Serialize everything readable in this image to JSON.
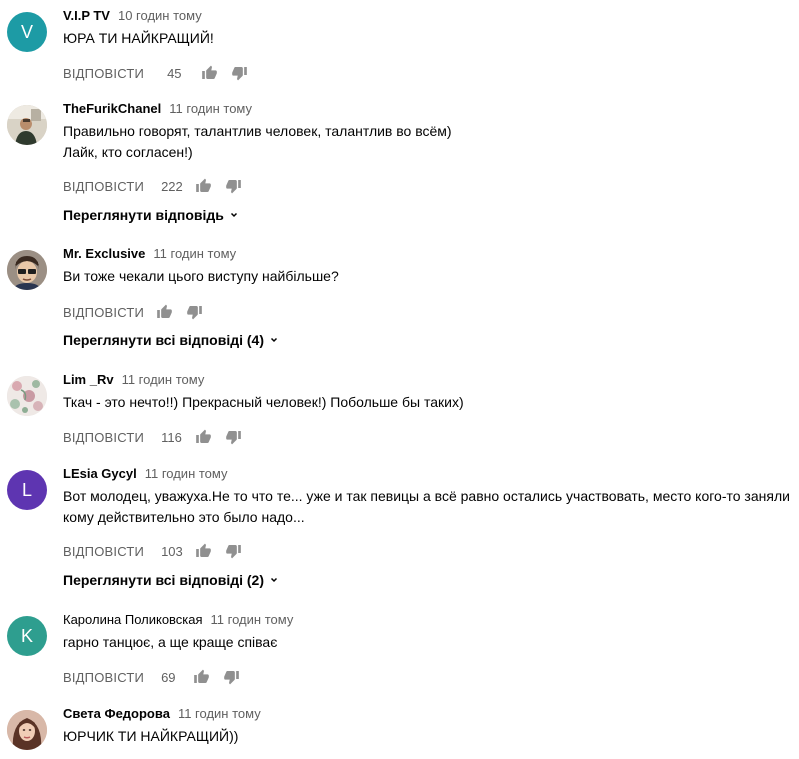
{
  "labels": {
    "reply": "ВІДПОВІСТИ"
  },
  "comments": [
    {
      "author": "V.I.P TV",
      "time": "10 годин тому",
      "lines": [
        "ЮРА ТИ НАЙКРАЩИЙ!"
      ],
      "likes": "45",
      "avatar": {
        "kind": "letter",
        "letter": "V",
        "color": "#1d9ba5"
      }
    },
    {
      "author": "TheFurikChanel",
      "time": "11 годин тому",
      "lines": [
        "Правильно говорят, талантлив человек, талантлив во всём)",
        "Лайк, кто согласен!)"
      ],
      "likes": "222",
      "avatar": {
        "kind": "photo",
        "icon": "man-in-room-photo"
      },
      "replies_label": "Переглянути відповідь"
    },
    {
      "author": "Mr. Exclusive",
      "time": "11 годин тому",
      "lines": [
        "Ви тоже чекали цього виступу найбільше?"
      ],
      "likes": "",
      "avatar": {
        "kind": "photo",
        "icon": "cartoon-glasses-avatar"
      },
      "replies_label": "Переглянути всі відповіді (4)"
    },
    {
      "author": "Lim _Rv",
      "time": "11 годин тому",
      "lines": [
        "Ткач - это нечто!!) Прекрасный человек!) Побольше бы таких)"
      ],
      "likes": "116",
      "avatar": {
        "kind": "photo",
        "icon": "floral-pattern-avatar"
      }
    },
    {
      "author": "LEsia Gycyl",
      "time": "11 годин тому",
      "lines": [
        "Вот молодец, уважуха.Не то что те... уже и так певицы а всё равно остались участвовать, место кого-то заняли",
        "кому действительно это было надо..."
      ],
      "likes": "103",
      "avatar": {
        "kind": "letter",
        "letter": "L",
        "color": "#5e35b1"
      },
      "replies_label": "Переглянути всі відповіді (2)"
    },
    {
      "author": "Каролина Поликовская",
      "time": "11 годин тому",
      "lines": [
        "гарно танцює, а ще краще співає"
      ],
      "likes": "69",
      "avatar": {
        "kind": "letter",
        "letter": "K",
        "color": "#2e9e8f"
      }
    },
    {
      "author": "Света Федорова",
      "time": "11 годин тому",
      "lines": [
        "ЮРЧИК ТИ НАЙКРАЩИЙ))"
      ],
      "likes": "",
      "avatar": {
        "kind": "photo",
        "icon": "woman-portrait-photo"
      }
    }
  ]
}
